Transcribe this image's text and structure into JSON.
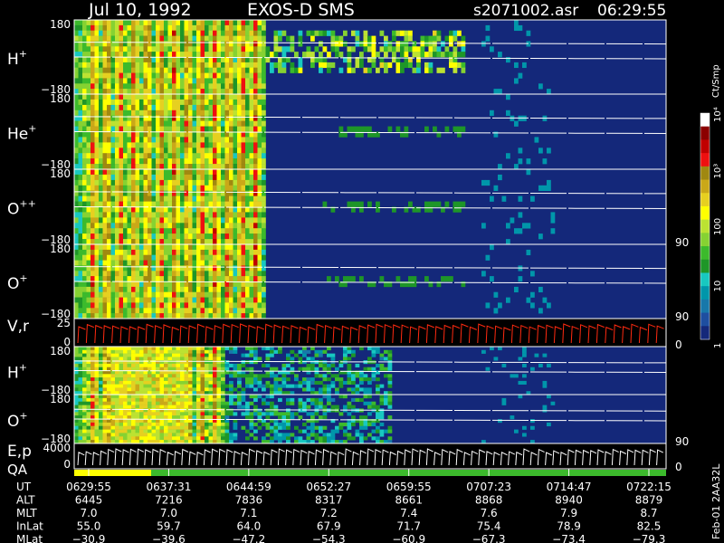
{
  "header": {
    "date": "Jul 10, 1992",
    "instrument": "EXOS-D SMS",
    "file": "s2071002.asr",
    "time": "06:29:55"
  },
  "colorbar": {
    "label": "Ct/Smp",
    "ticks": [
      "10⁴",
      "10³",
      "100",
      "10",
      "1"
    ],
    "tick_values": [
      10000,
      1000,
      100,
      10,
      1
    ],
    "colors": [
      "#ffffff",
      "#8b0000",
      "#c00000",
      "#ee1010",
      "#a08810",
      "#caa818",
      "#e6d020",
      "#ffff00",
      "#bce232",
      "#86d232",
      "#3cba2c",
      "#1e9628",
      "#18c8c0",
      "#0096aa",
      "#1878aa",
      "#1e4ea0",
      "#14287a"
    ]
  },
  "panels": [
    {
      "id": "h-plus",
      "label": "H",
      "sup": "+",
      "ymax": "180",
      "ymin": "−180"
    },
    {
      "id": "he-plus",
      "label": "He",
      "sup": "+",
      "ymax": "180",
      "ymin": "−180"
    },
    {
      "id": "o-plusplus",
      "label": "O",
      "sup": "++",
      "ymax": "180",
      "ymin": "−180",
      "right": "90"
    },
    {
      "id": "o-plus",
      "label": "O",
      "sup": "+",
      "ymax": "180",
      "ymin": "−180",
      "right": "90"
    },
    {
      "id": "vr",
      "label": "V,r",
      "sup": "",
      "ymax": "25",
      "ymin": "0",
      "right": "0"
    },
    {
      "id": "h-plus-2",
      "label": "H",
      "sup": "+",
      "ymax": "180",
      "ymin": "−180"
    },
    {
      "id": "o-plus-2",
      "label": "O",
      "sup": "+",
      "ymax": "180",
      "ymin": "−180",
      "right": "90"
    },
    {
      "id": "ep",
      "label": "E,p",
      "sup": "",
      "ymax": "4000",
      "ymin": "0",
      "right": "0"
    }
  ],
  "qa_label": "QA",
  "footer_side": "Feb-01 2AA32L",
  "ephemeris": {
    "rows": [
      {
        "label": "UT",
        "values": [
          "0629:55",
          "0637:31",
          "0644:59",
          "0652:27",
          "0659:55",
          "0707:23",
          "0714:47",
          "0722:15"
        ]
      },
      {
        "label": "ALT",
        "values": [
          "6445",
          "7216",
          "7836",
          "8317",
          "8661",
          "8868",
          "8940",
          "8879"
        ]
      },
      {
        "label": "MLT",
        "values": [
          "7.0",
          "7.0",
          "7.1",
          "7.2",
          "7.4",
          "7.6",
          "7.9",
          "8.7"
        ]
      },
      {
        "label": "InLat",
        "values": [
          "55.0",
          "59.7",
          "64.0",
          "67.9",
          "71.7",
          "75.4",
          "78.9",
          "82.5"
        ]
      },
      {
        "label": "MLat",
        "values": [
          "−30.9",
          "−39.6",
          "−47.2",
          "−54.3",
          "−60.9",
          "−67.3",
          "−73.4",
          "−79.3"
        ]
      }
    ]
  },
  "chart_data": {
    "type": "heatmap",
    "title": "Jul 10, 1992   EXOS-D SMS",
    "x_ticks": [
      "0629:55",
      "0637:31",
      "0644:59",
      "0652:27",
      "0659:55",
      "0707:23",
      "0714:47",
      "0722:15"
    ],
    "y_axes": [
      {
        "panel": "H+",
        "ylim": [
          -180,
          180
        ]
      },
      {
        "panel": "He+",
        "ylim": [
          -180,
          180
        ]
      },
      {
        "panel": "O++",
        "ylim": [
          -180,
          180
        ]
      },
      {
        "panel": "O+",
        "ylim": [
          -180,
          180
        ]
      },
      {
        "panel": "V,r",
        "ylim": [
          0,
          25
        ]
      },
      {
        "panel": "H+",
        "ylim": [
          -180,
          180
        ]
      },
      {
        "panel": "O+",
        "ylim": [
          -180,
          180
        ]
      },
      {
        "panel": "E,p",
        "ylim": [
          0,
          4000
        ]
      }
    ],
    "color_scale": {
      "type": "log",
      "min": 1,
      "max": 10000,
      "label": "Ct/Smp"
    }
  }
}
